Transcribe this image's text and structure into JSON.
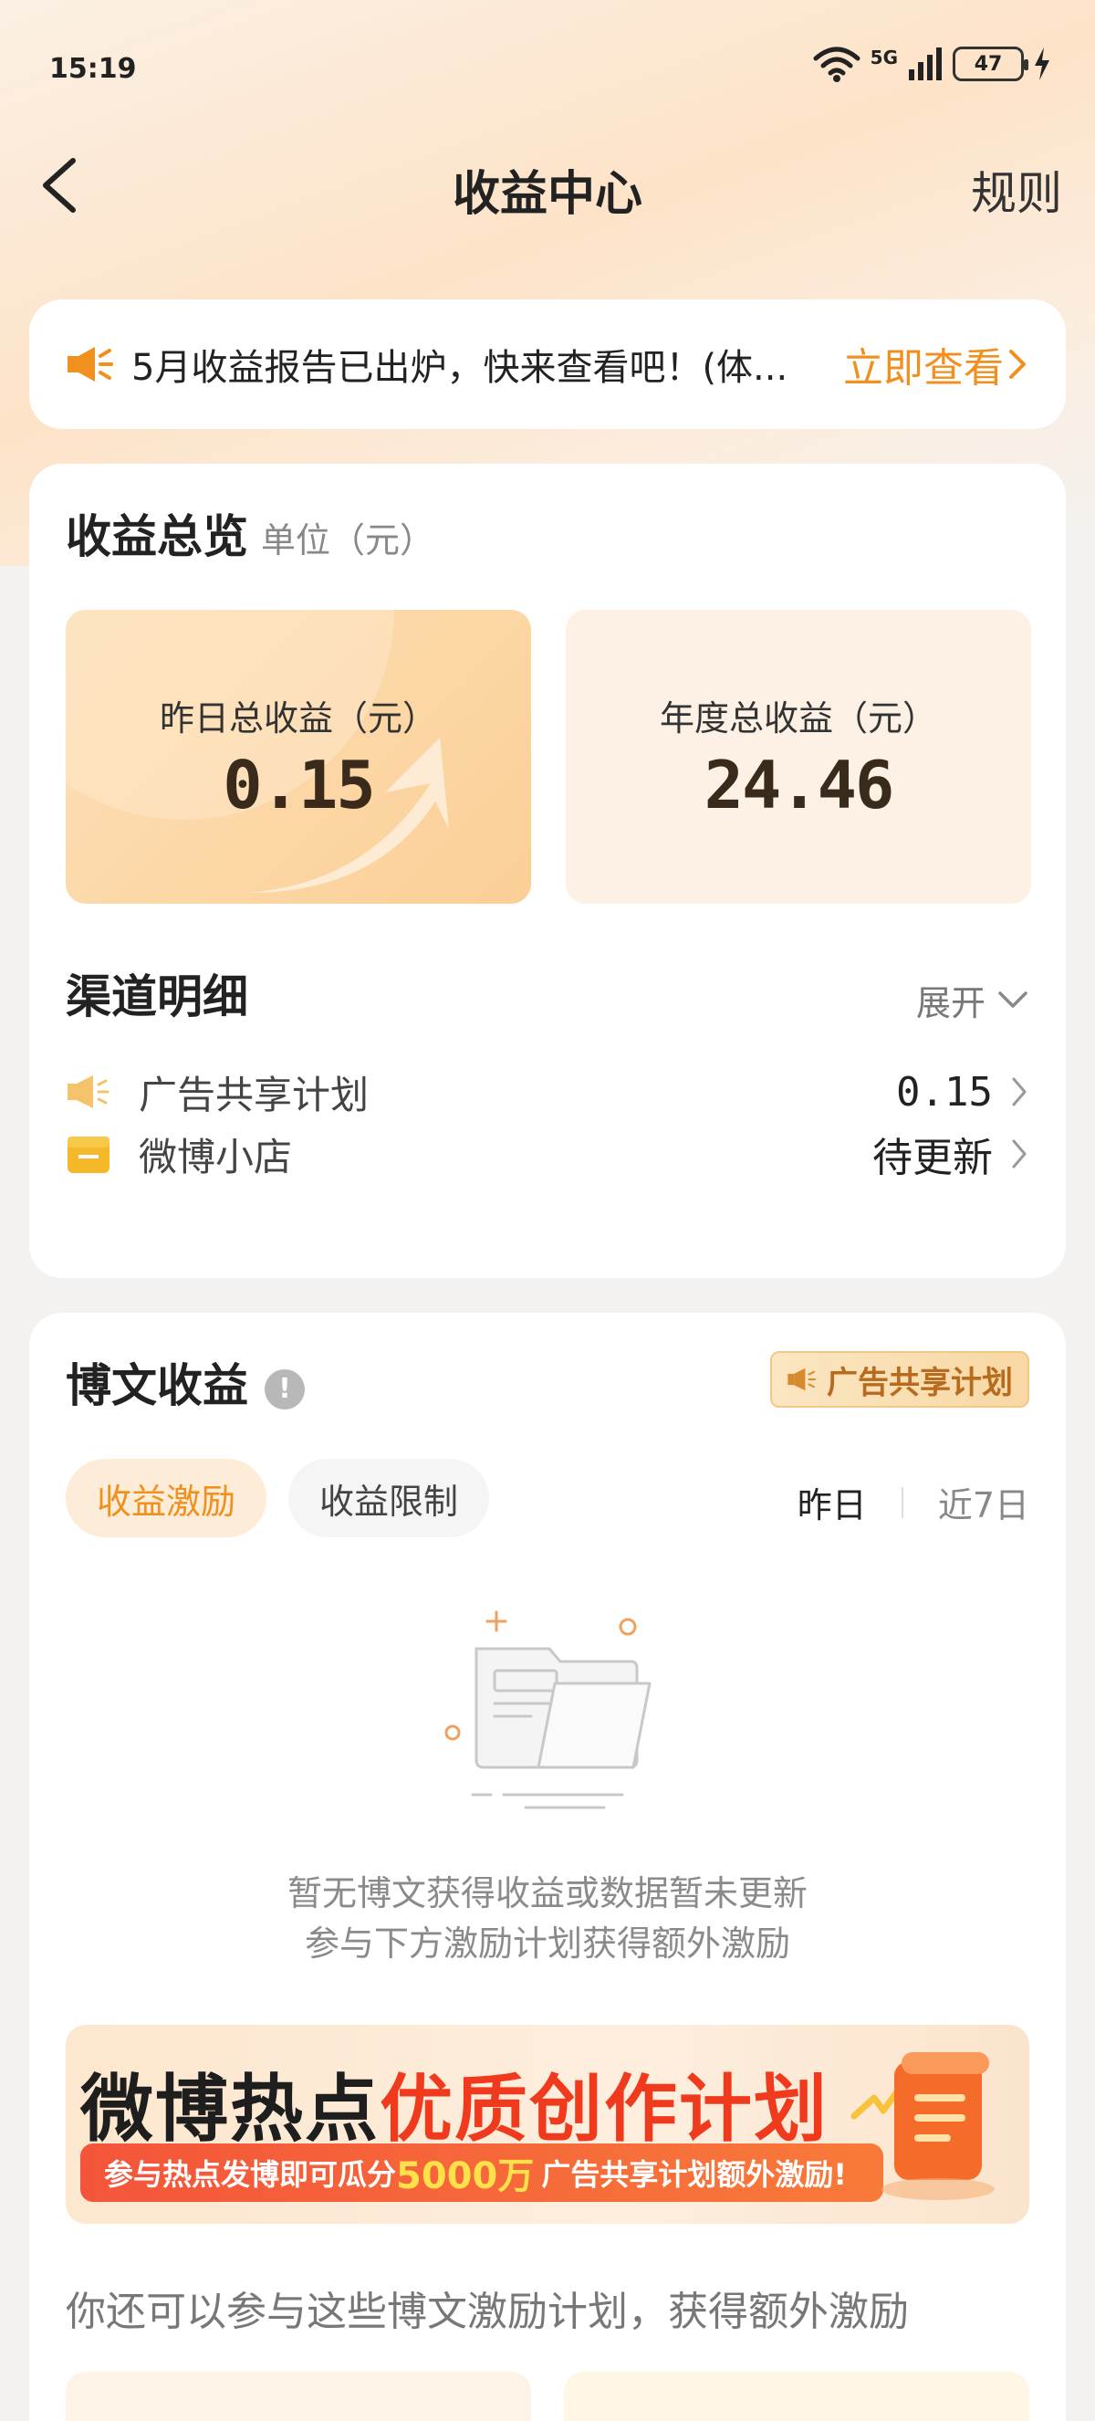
{
  "status_bar": {
    "time": "15:19",
    "network": "5G",
    "battery": "47"
  },
  "nav": {
    "title": "收益中心",
    "rules": "规则"
  },
  "notice": {
    "text": "5月收益报告已出炉，快来查看吧！(体...",
    "link": "立即查看"
  },
  "overview": {
    "title": "收益总览",
    "unit": "单位（元）",
    "yesterday_label": "昨日总收益（元）",
    "yesterday_value": "0.15",
    "annual_label": "年度总收益（元）",
    "annual_value": "24.46"
  },
  "channels": {
    "title": "渠道明细",
    "expand": "展开",
    "items": [
      {
        "label": "广告共享计划",
        "value": "0.15"
      },
      {
        "label": "微博小店",
        "value": "待更新"
      }
    ]
  },
  "weibo_income": {
    "title": "博文收益",
    "badge": "广告共享计划",
    "tabs": [
      "收益激励",
      "收益限制"
    ],
    "range": [
      "昨日",
      "近7日"
    ],
    "empty_line1": "暂无博文获得收益或数据暂未更新",
    "empty_line2": "参与下方激励计划获得额外激励",
    "banner": {
      "title_part1": "微博热点",
      "title_part2": "优质创作计划",
      "strip_pre": "参与热点发博即可瓜分",
      "strip_amount": "5000万",
      "strip_post": "广告共享计划额外激励!"
    },
    "more_text": "你还可以参与这些博文激励计划，获得额外激励"
  }
}
